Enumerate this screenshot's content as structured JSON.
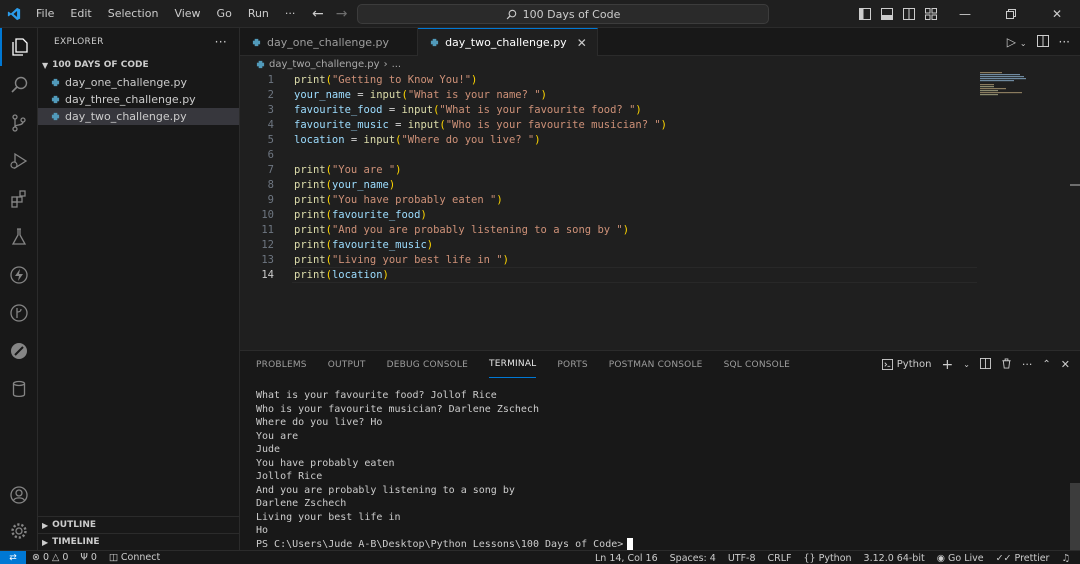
{
  "titlebar": {
    "menu": [
      "File",
      "Edit",
      "Selection",
      "View",
      "Go",
      "Run",
      "···"
    ],
    "search_text": "100 Days of Code"
  },
  "explorer": {
    "header": "EXPLORER",
    "folder": "100 DAYS OF CODE",
    "files": [
      "day_one_challenge.py",
      "day_three_challenge.py",
      "day_two_challenge.py"
    ],
    "outline": "OUTLINE",
    "timeline": "TIMELINE"
  },
  "editor": {
    "tabs": [
      "day_one_challenge.py",
      "day_two_challenge.py"
    ],
    "breadcrumb_file": "day_two_challenge.py",
    "breadcrumb_more": "...",
    "line_numbers": [
      "1",
      "2",
      "3",
      "4",
      "5",
      "6",
      "7",
      "8",
      "9",
      "10",
      "11",
      "12",
      "13",
      "14"
    ],
    "code": {
      "l1": "\"Getting to Know You!\"",
      "l2_var": "your_name",
      "l2_str": "\"What is your name? \"",
      "l3_var": "favourite_food",
      "l3_str": "\"What is your favourite food? \"",
      "l4_var": "favourite_music",
      "l4_str": "\"Who is your favourite musician? \"",
      "l5_var": "location",
      "l5_str": "\"Where do you live? \"",
      "l7": "\"You are \"",
      "l8": "your_name",
      "l9": "\"You have probably eaten \"",
      "l10": "favourite_food",
      "l11": "\"And you are probably listening to a song by \"",
      "l12": "favourite_music",
      "l13": "\"Living your best life in \"",
      "l14": "location",
      "fn_print": "print",
      "fn_input": "input"
    }
  },
  "panel": {
    "tabs": [
      "PROBLEMS",
      "OUTPUT",
      "DEBUG CONSOLE",
      "TERMINAL",
      "PORTS",
      "POSTMAN CONSOLE",
      "SQL CONSOLE"
    ],
    "terminal_profile": "Python",
    "terminal_lines": [
      "What is your favourite food? Jollof Rice",
      "Who is your favourite musician? Darlene Zschech",
      "Where do you live? Ho",
      "You are",
      "Jude",
      "You have probably eaten",
      "Jollof Rice",
      "And you are probably listening to a song by",
      "Darlene Zschech",
      "Living your best life in",
      "Ho"
    ],
    "prompt": "PS C:\\Users\\Jude A-B\\Desktop\\Python Lessons\\100 Days of Code>"
  },
  "statusbar": {
    "errors": "0",
    "warnings": "0",
    "ports": "0",
    "connect": "Connect",
    "position": "Ln 14, Col 16",
    "spaces": "Spaces: 4",
    "encoding": "UTF-8",
    "eol": "CRLF",
    "language": "Python",
    "interpreter": "3.12.0 64-bit",
    "golive": "Go Live",
    "prettier": "Prettier"
  },
  "colors": {
    "accent": "#0078d4",
    "string": "#ce9178",
    "function": "#dcdcaa",
    "variable": "#9cdcfe",
    "python_icon": "#519aba"
  }
}
